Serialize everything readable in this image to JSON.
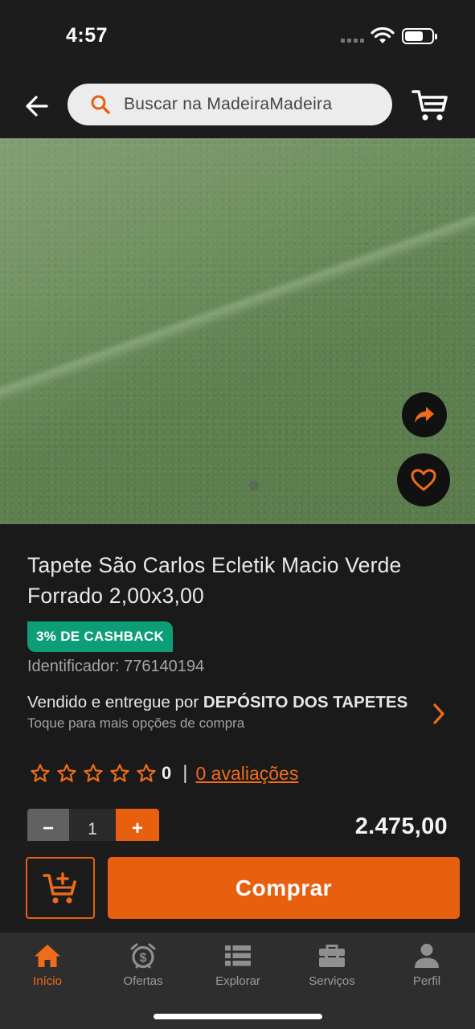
{
  "status_bar": {
    "time": "4:57"
  },
  "header": {
    "search_placeholder": "Buscar na MadeiraMadeira"
  },
  "product": {
    "title": "Tapete São Carlos Ecletik Macio Verde Forrado 2,00x3,00",
    "cashback_badge": "3% DE CASHBACK",
    "identifier": "Identificador: 776140194",
    "seller_prefix": "Vendido e entregue por ",
    "seller_name": "DEPÓSITO DOS TAPETES",
    "seller_subtitle": "Toque para mais opções de compra",
    "rating_stars": 0,
    "rating_count": "0",
    "rating_separator": "|",
    "reviews_link": "0 avaliações",
    "quantity": "1",
    "qty_minus": "−",
    "qty_plus": "+",
    "price": "2.475,00"
  },
  "actions": {
    "buy_label": "Comprar"
  },
  "tabbar": {
    "items": [
      {
        "label": "Início",
        "icon": "home-icon",
        "active": true
      },
      {
        "label": "Ofertas",
        "icon": "alarm-dollar-icon",
        "active": false
      },
      {
        "label": "Explorar",
        "icon": "list-icon",
        "active": false
      },
      {
        "label": "Serviços",
        "icon": "toolbox-icon",
        "active": false
      },
      {
        "label": "Perfil",
        "icon": "person-icon",
        "active": false
      }
    ]
  },
  "colors": {
    "accent": "#E8600F",
    "cashback": "#0D9E78",
    "background": "#1A1A1A"
  }
}
